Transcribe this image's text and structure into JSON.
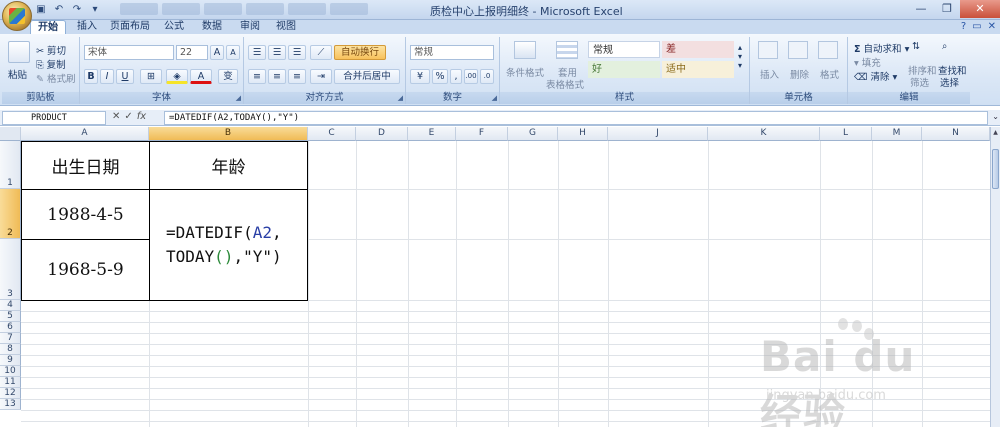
{
  "titlebar": {
    "title": "质检中心上报明细终 - Microsoft Excel",
    "controls": [
      "—",
      "❐",
      "✕"
    ]
  },
  "tabs": [
    "开始",
    "插入",
    "页面布局",
    "公式",
    "数据",
    "审阅",
    "视图"
  ],
  "active_tab": "开始",
  "ribbon": {
    "clipboard": {
      "label": "剪贴板",
      "paste": "粘贴",
      "cut": "剪切",
      "copy": "复制",
      "format_painter": "格式刷"
    },
    "font": {
      "label": "字体",
      "font_name": "宋体",
      "font_size": "22",
      "grow": "A",
      "shrink": "A",
      "bold": "B",
      "italic": "I",
      "underline": "U",
      "font_color": "A",
      "wen": "变"
    },
    "alignment": {
      "label": "对齐方式",
      "wrap": "自动换行",
      "merge": "合并后居中"
    },
    "number": {
      "label": "数字",
      "format": "常规",
      "percent": "%",
      "comma": ",",
      "inc": ".00",
      "dec": ".0"
    },
    "styles": {
      "label": "样式",
      "conditional": "条件格式",
      "table": "套用",
      "table2": "表格格式",
      "normal": "常规",
      "bad": "差",
      "good": "好",
      "neutral": "适中"
    },
    "cells": {
      "label": "单元格",
      "insert": "插入",
      "delete": "删除",
      "format": "格式"
    },
    "editing": {
      "label": "编辑",
      "autosum": "自动求和",
      "fill": "填充",
      "clear": "清除",
      "sort": "排序和",
      "sort2": "筛选",
      "find": "查找和",
      "find2": "选择"
    }
  },
  "formula_bar": {
    "name_box": "PRODUCT",
    "formula": "=DATEDIF(A2,TODAY(),\"Y\")"
  },
  "columns": [
    "A",
    "B",
    "C",
    "D",
    "E",
    "F",
    "G",
    "H",
    "J",
    "K",
    "L",
    "M",
    "N"
  ],
  "rows": [
    "1",
    "2",
    "3",
    "4",
    "5",
    "6",
    "7",
    "8",
    "9",
    "10",
    "11",
    "12",
    "13"
  ],
  "cells": {
    "a1": "出生日期",
    "b1": "年龄",
    "a2": "1988-4-5",
    "a3": "1968-5-9",
    "b2_part1": "=DATEDIF(",
    "b2_ref": "A2",
    "b2_comma": ",",
    "b2_part2": "TODAY",
    "b2_paren": "()",
    "b2_part3": ",\"Y\")"
  },
  "watermark": {
    "brand": "Bai du 经验",
    "url": "jingyan.baidu.com"
  }
}
